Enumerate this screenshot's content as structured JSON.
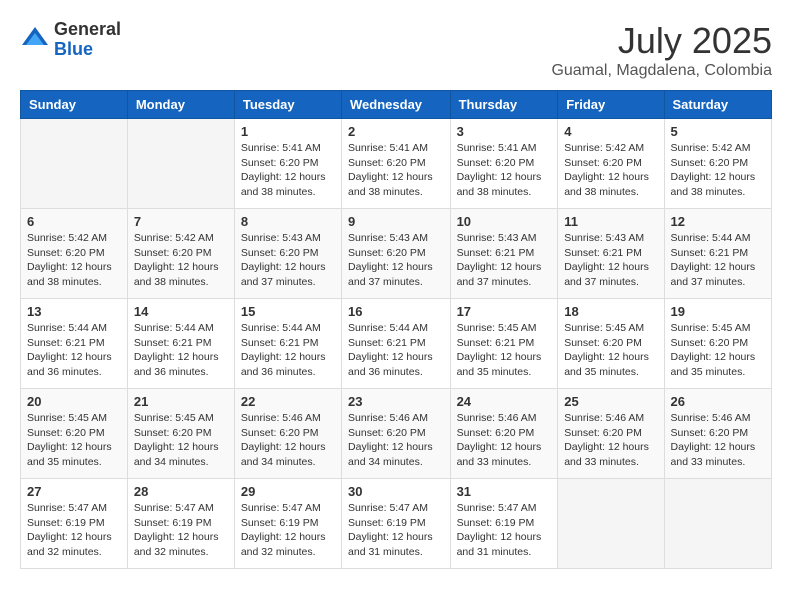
{
  "header": {
    "logo_general": "General",
    "logo_blue": "Blue",
    "month": "July 2025",
    "location": "Guamal, Magdalena, Colombia"
  },
  "weekdays": [
    "Sunday",
    "Monday",
    "Tuesday",
    "Wednesday",
    "Thursday",
    "Friday",
    "Saturday"
  ],
  "weeks": [
    [
      {
        "day": "",
        "info": ""
      },
      {
        "day": "",
        "info": ""
      },
      {
        "day": "1",
        "info": "Sunrise: 5:41 AM\nSunset: 6:20 PM\nDaylight: 12 hours and 38 minutes."
      },
      {
        "day": "2",
        "info": "Sunrise: 5:41 AM\nSunset: 6:20 PM\nDaylight: 12 hours and 38 minutes."
      },
      {
        "day": "3",
        "info": "Sunrise: 5:41 AM\nSunset: 6:20 PM\nDaylight: 12 hours and 38 minutes."
      },
      {
        "day": "4",
        "info": "Sunrise: 5:42 AM\nSunset: 6:20 PM\nDaylight: 12 hours and 38 minutes."
      },
      {
        "day": "5",
        "info": "Sunrise: 5:42 AM\nSunset: 6:20 PM\nDaylight: 12 hours and 38 minutes."
      }
    ],
    [
      {
        "day": "6",
        "info": "Sunrise: 5:42 AM\nSunset: 6:20 PM\nDaylight: 12 hours and 38 minutes."
      },
      {
        "day": "7",
        "info": "Sunrise: 5:42 AM\nSunset: 6:20 PM\nDaylight: 12 hours and 38 minutes."
      },
      {
        "day": "8",
        "info": "Sunrise: 5:43 AM\nSunset: 6:20 PM\nDaylight: 12 hours and 37 minutes."
      },
      {
        "day": "9",
        "info": "Sunrise: 5:43 AM\nSunset: 6:20 PM\nDaylight: 12 hours and 37 minutes."
      },
      {
        "day": "10",
        "info": "Sunrise: 5:43 AM\nSunset: 6:21 PM\nDaylight: 12 hours and 37 minutes."
      },
      {
        "day": "11",
        "info": "Sunrise: 5:43 AM\nSunset: 6:21 PM\nDaylight: 12 hours and 37 minutes."
      },
      {
        "day": "12",
        "info": "Sunrise: 5:44 AM\nSunset: 6:21 PM\nDaylight: 12 hours and 37 minutes."
      }
    ],
    [
      {
        "day": "13",
        "info": "Sunrise: 5:44 AM\nSunset: 6:21 PM\nDaylight: 12 hours and 36 minutes."
      },
      {
        "day": "14",
        "info": "Sunrise: 5:44 AM\nSunset: 6:21 PM\nDaylight: 12 hours and 36 minutes."
      },
      {
        "day": "15",
        "info": "Sunrise: 5:44 AM\nSunset: 6:21 PM\nDaylight: 12 hours and 36 minutes."
      },
      {
        "day": "16",
        "info": "Sunrise: 5:44 AM\nSunset: 6:21 PM\nDaylight: 12 hours and 36 minutes."
      },
      {
        "day": "17",
        "info": "Sunrise: 5:45 AM\nSunset: 6:21 PM\nDaylight: 12 hours and 35 minutes."
      },
      {
        "day": "18",
        "info": "Sunrise: 5:45 AM\nSunset: 6:20 PM\nDaylight: 12 hours and 35 minutes."
      },
      {
        "day": "19",
        "info": "Sunrise: 5:45 AM\nSunset: 6:20 PM\nDaylight: 12 hours and 35 minutes."
      }
    ],
    [
      {
        "day": "20",
        "info": "Sunrise: 5:45 AM\nSunset: 6:20 PM\nDaylight: 12 hours and 35 minutes."
      },
      {
        "day": "21",
        "info": "Sunrise: 5:45 AM\nSunset: 6:20 PM\nDaylight: 12 hours and 34 minutes."
      },
      {
        "day": "22",
        "info": "Sunrise: 5:46 AM\nSunset: 6:20 PM\nDaylight: 12 hours and 34 minutes."
      },
      {
        "day": "23",
        "info": "Sunrise: 5:46 AM\nSunset: 6:20 PM\nDaylight: 12 hours and 34 minutes."
      },
      {
        "day": "24",
        "info": "Sunrise: 5:46 AM\nSunset: 6:20 PM\nDaylight: 12 hours and 33 minutes."
      },
      {
        "day": "25",
        "info": "Sunrise: 5:46 AM\nSunset: 6:20 PM\nDaylight: 12 hours and 33 minutes."
      },
      {
        "day": "26",
        "info": "Sunrise: 5:46 AM\nSunset: 6:20 PM\nDaylight: 12 hours and 33 minutes."
      }
    ],
    [
      {
        "day": "27",
        "info": "Sunrise: 5:47 AM\nSunset: 6:19 PM\nDaylight: 12 hours and 32 minutes."
      },
      {
        "day": "28",
        "info": "Sunrise: 5:47 AM\nSunset: 6:19 PM\nDaylight: 12 hours and 32 minutes."
      },
      {
        "day": "29",
        "info": "Sunrise: 5:47 AM\nSunset: 6:19 PM\nDaylight: 12 hours and 32 minutes."
      },
      {
        "day": "30",
        "info": "Sunrise: 5:47 AM\nSunset: 6:19 PM\nDaylight: 12 hours and 31 minutes."
      },
      {
        "day": "31",
        "info": "Sunrise: 5:47 AM\nSunset: 6:19 PM\nDaylight: 12 hours and 31 minutes."
      },
      {
        "day": "",
        "info": ""
      },
      {
        "day": "",
        "info": ""
      }
    ]
  ]
}
